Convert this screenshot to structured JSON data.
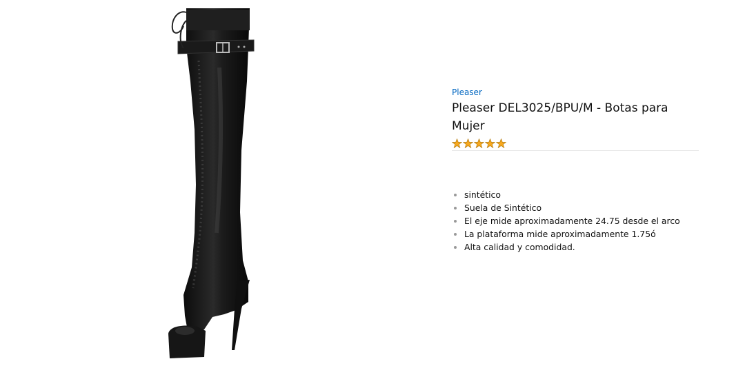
{
  "product": {
    "brand": "Pleaser",
    "title": "Pleaser DEL3025/BPU/M - Botas para Mujer",
    "rating": {
      "value": 5,
      "max": 5
    },
    "image_icon": "thigh-high-boot",
    "features": [
      "sintético",
      "Suela de Sintético",
      "El eje mide aproximadamente 24.75 desde el arco",
      "La plataforma mide aproximadamente 1.75ó",
      "Alta calidad y comodidad."
    ]
  },
  "colors": {
    "brand_link": "#0066c0",
    "star": "#f7a81e",
    "star_outline": "#b57a0a",
    "text": "#111111",
    "boot": "#151515"
  }
}
